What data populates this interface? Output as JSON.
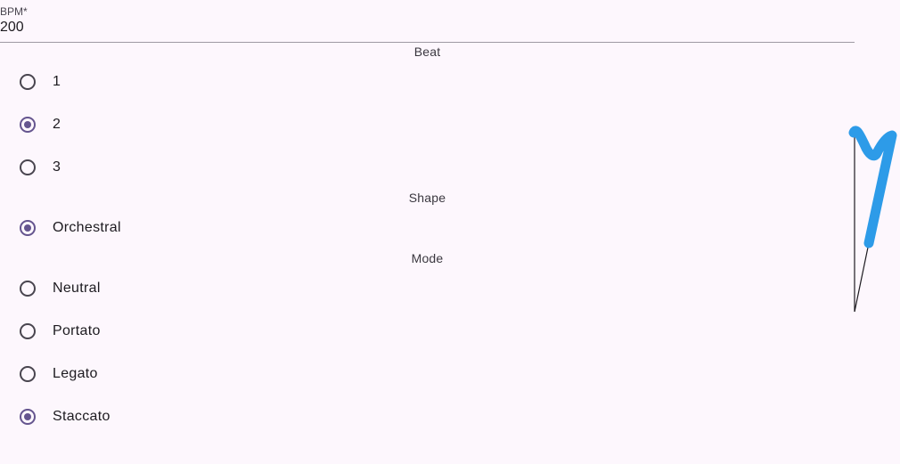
{
  "bpm": {
    "label": "BPM*",
    "value": "200"
  },
  "beat": {
    "title": "Beat",
    "options": [
      {
        "label": "1",
        "selected": false
      },
      {
        "label": "2",
        "selected": true
      },
      {
        "label": "3",
        "selected": false
      }
    ]
  },
  "shape": {
    "title": "Shape",
    "options": [
      {
        "label": "Orchestral",
        "selected": true
      }
    ]
  },
  "mode": {
    "title": "Mode",
    "options": [
      {
        "label": "Neutral",
        "selected": false
      },
      {
        "label": "Portato",
        "selected": false
      },
      {
        "label": "Legato",
        "selected": false
      },
      {
        "label": "Staccato",
        "selected": true
      }
    ]
  },
  "colors": {
    "accent": "#65558f",
    "stroke": "#2d9be8",
    "background": "#fdf7fd"
  },
  "icons": {
    "conductor": "conducting-pattern-icon"
  }
}
